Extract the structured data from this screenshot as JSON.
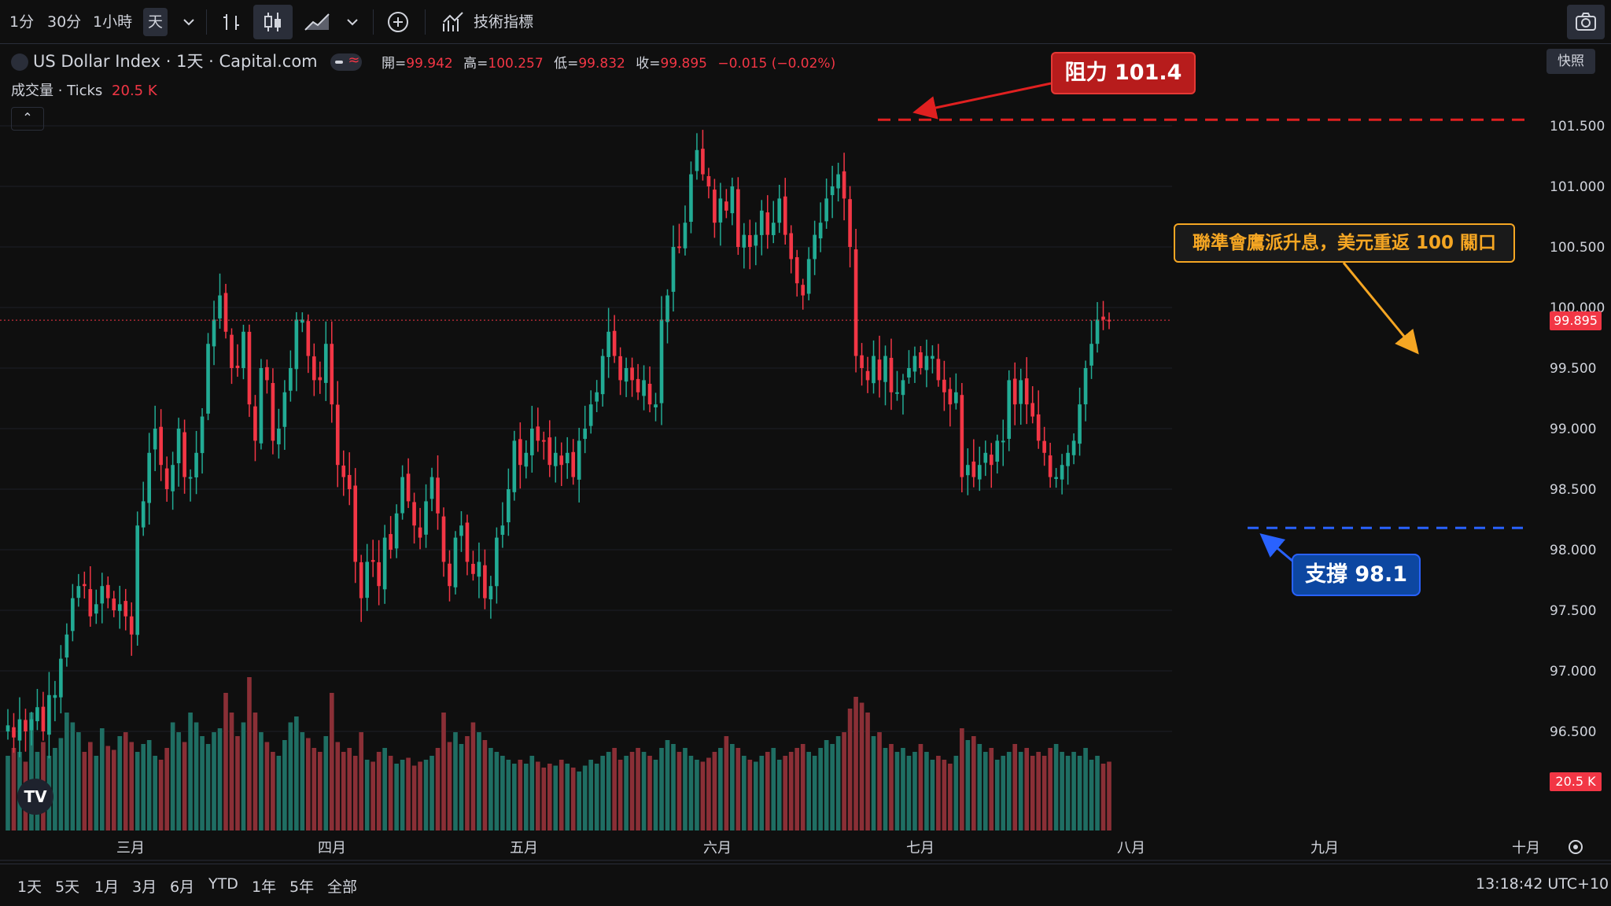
{
  "toolbar": {
    "intervals": [
      "1分",
      "30分",
      "1小時",
      "天"
    ],
    "indicators_label": "技術指標"
  },
  "legend": {
    "symbol": "US Dollar Index · 1天 · Capital.com",
    "ohlc": {
      "open_label": "開=",
      "open": "99.942",
      "high_label": "高=",
      "high": "100.257",
      "low_label": "低=",
      "low": "99.832",
      "close_label": "收=",
      "close": "99.895",
      "change": "−0.015 (−0.02%)"
    },
    "volume_label": "成交量 · Ticks",
    "volume_value": "20.5 K"
  },
  "snapshot_label": "快照",
  "bottom": {
    "ranges": [
      "1天",
      "5天",
      "1月",
      "3月",
      "6月",
      "YTD",
      "1年",
      "5年",
      "全部"
    ],
    "time": "13:18:42 UTC+10"
  },
  "annotations": {
    "resistance": "阻力 101.4",
    "support": "支撐 98.1",
    "news": "聯準會鷹派升息，美元重返 100 關口"
  },
  "colors": {
    "up": "#22ab94",
    "down": "#f23645",
    "up_volume": "#1f6e63",
    "down_volume": "#8a2f36",
    "resistance": "#e02020",
    "support": "#2962ff",
    "news": "#f5a623"
  },
  "chart_data": {
    "type": "candlestick",
    "ylim": [
      96.0,
      101.8
    ],
    "y_ticks": [
      "96.500",
      "97.000",
      "97.500",
      "98.000",
      "98.500",
      "99.000",
      "99.500",
      "100.000",
      "100.500",
      "101.000",
      "101.500"
    ],
    "x_ticks": [
      "三月",
      "四月",
      "五月",
      "六月",
      "七月",
      "八月",
      "九月",
      "十月"
    ],
    "last_price": "99.895",
    "last_volume": "20.5 K",
    "resistance_level": 101.55,
    "support_level": 98.18,
    "closes": [
      96.55,
      96.45,
      96.6,
      96.5,
      96.6,
      96.7,
      96.5,
      96.8,
      96.8,
      97.1,
      97.3,
      97.6,
      97.7,
      97.7,
      97.45,
      97.55,
      97.7,
      97.6,
      97.5,
      97.55,
      97.45,
      97.3,
      98.2,
      98.4,
      98.8,
      99.0,
      98.7,
      98.5,
      98.7,
      99.0,
      98.6,
      98.6,
      98.8,
      99.1,
      99.7,
      99.9,
      100.1,
      99.8,
      99.5,
      99.5,
      99.8,
      99.2,
      98.9,
      99.5,
      99.4,
      98.9,
      99.0,
      99.3,
      99.5,
      99.9,
      99.9,
      99.6,
      99.4,
      99.4,
      99.7,
      99.2,
      98.7,
      98.6,
      98.5,
      97.9,
      97.6,
      97.9,
      97.9,
      97.7,
      98.1,
      98.0,
      98.3,
      98.6,
      98.4,
      98.2,
      98.1,
      98.4,
      98.6,
      98.3,
      97.9,
      97.7,
      98.1,
      98.2,
      97.9,
      97.8,
      97.9,
      97.6,
      97.7,
      98.1,
      98.2,
      98.5,
      98.9,
      98.7,
      98.8,
      99.0,
      98.9,
      98.9,
      98.7,
      98.8,
      98.7,
      98.8,
      98.6,
      98.9,
      99.0,
      99.2,
      99.3,
      99.6,
      99.8,
      99.6,
      99.4,
      99.5,
      99.4,
      99.3,
      99.4,
      99.2,
      99.2,
      99.9,
      100.1,
      100.5,
      100.5,
      100.7,
      101.1,
      101.3,
      101.1,
      101.0,
      100.7,
      100.9,
      100.8,
      101.0,
      100.5,
      100.6,
      100.5,
      100.6,
      100.8,
      100.6,
      100.7,
      100.9,
      100.6,
      100.4,
      100.2,
      100.1,
      100.4,
      100.6,
      100.7,
      100.9,
      101.0,
      101.1,
      100.9,
      100.5,
      99.6,
      99.5,
      99.4,
      99.6,
      99.4,
      99.6,
      99.3,
      99.3,
      99.4,
      99.5,
      99.6,
      99.5,
      99.6,
      99.6,
      99.4,
      99.3,
      99.2,
      99.3,
      98.6,
      98.7,
      98.6,
      98.7,
      98.8,
      98.7,
      98.9,
      98.9,
      99.4,
      99.2,
      99.4,
      99.2,
      99.1,
      98.9,
      98.8,
      98.6,
      98.6,
      98.7,
      98.8,
      98.9,
      99.2,
      99.5,
      99.7,
      99.9,
      99.9,
      99.89
    ],
    "volumes": [
      0.38,
      0.42,
      0.4,
      0.35,
      0.6,
      0.4,
      0.45,
      0.38,
      0.42,
      0.47,
      0.6,
      0.55,
      0.5,
      0.4,
      0.45,
      0.38,
      0.52,
      0.43,
      0.41,
      0.48,
      0.5,
      0.45,
      0.4,
      0.44,
      0.46,
      0.38,
      0.36,
      0.42,
      0.55,
      0.5,
      0.45,
      0.6,
      0.55,
      0.48,
      0.44,
      0.5,
      0.52,
      0.7,
      0.6,
      0.48,
      0.55,
      0.78,
      0.6,
      0.5,
      0.45,
      0.4,
      0.38,
      0.46,
      0.55,
      0.58,
      0.5,
      0.47,
      0.42,
      0.4,
      0.48,
      0.7,
      0.45,
      0.4,
      0.42,
      0.38,
      0.5,
      0.36,
      0.35,
      0.4,
      0.42,
      0.38,
      0.34,
      0.36,
      0.37,
      0.33,
      0.35,
      0.36,
      0.38,
      0.42,
      0.6,
      0.45,
      0.5,
      0.44,
      0.48,
      0.55,
      0.5,
      0.46,
      0.42,
      0.4,
      0.38,
      0.36,
      0.34,
      0.36,
      0.34,
      0.38,
      0.35,
      0.32,
      0.34,
      0.33,
      0.36,
      0.34,
      0.32,
      0.3,
      0.33,
      0.36,
      0.34,
      0.38,
      0.4,
      0.42,
      0.36,
      0.38,
      0.4,
      0.42,
      0.4,
      0.38,
      0.36,
      0.42,
      0.46,
      0.44,
      0.4,
      0.42,
      0.38,
      0.36,
      0.35,
      0.37,
      0.4,
      0.42,
      0.48,
      0.44,
      0.42,
      0.38,
      0.36,
      0.35,
      0.38,
      0.4,
      0.42,
      0.36,
      0.38,
      0.4,
      0.42,
      0.44,
      0.4,
      0.38,
      0.42,
      0.46,
      0.44,
      0.48,
      0.5,
      0.62,
      0.68,
      0.65,
      0.6,
      0.48,
      0.5,
      0.42,
      0.44,
      0.4,
      0.42,
      0.38,
      0.4,
      0.44,
      0.4,
      0.36,
      0.38,
      0.36,
      0.34,
      0.38,
      0.52,
      0.46,
      0.48,
      0.44,
      0.4,
      0.42,
      0.36,
      0.38,
      0.4,
      0.44,
      0.4,
      0.42,
      0.38,
      0.4,
      0.38,
      0.42,
      0.44,
      0.4,
      0.38,
      0.4,
      0.38,
      0.42,
      0.36,
      0.38,
      0.34,
      0.35
    ]
  }
}
